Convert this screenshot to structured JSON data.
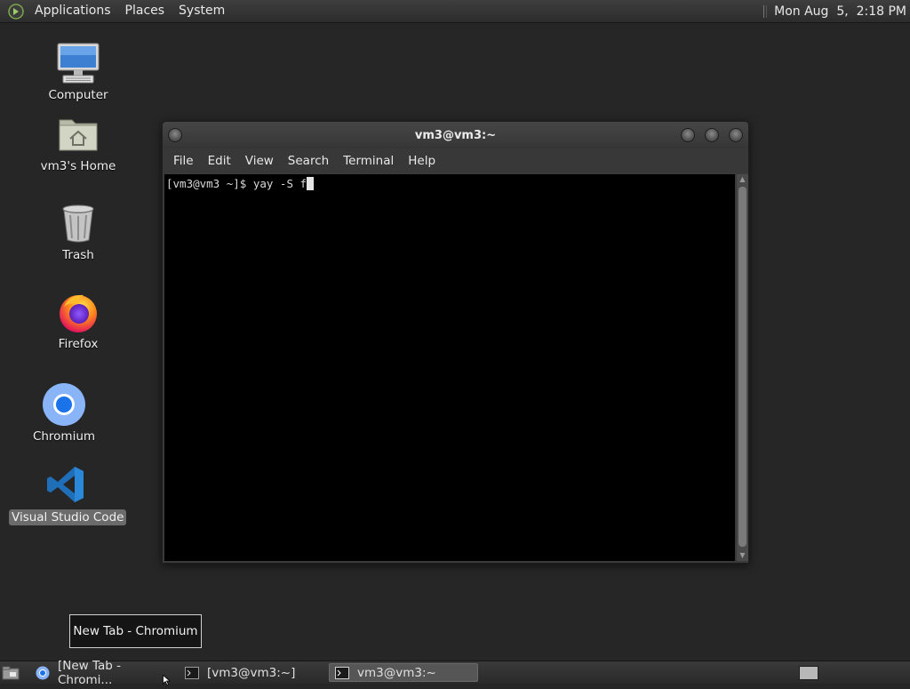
{
  "top_panel": {
    "menus": [
      "Applications",
      "Places",
      "System"
    ],
    "clock": "Mon Aug  5,  2:18 PM"
  },
  "desktop": {
    "icons": [
      {
        "label": "Computer",
        "icon": "computer-icon"
      },
      {
        "label": "vm3's Home",
        "icon": "home-folder-icon"
      },
      {
        "label": "Trash",
        "icon": "trash-icon"
      },
      {
        "label": "Firefox",
        "icon": "firefox-icon"
      },
      {
        "label": "Chromium",
        "icon": "chromium-icon"
      },
      {
        "label": "Visual Studio Code",
        "icon": "vscode-icon",
        "selected": true
      }
    ]
  },
  "terminal": {
    "title": "vm3@vm3:~",
    "menu": [
      "File",
      "Edit",
      "View",
      "Search",
      "Terminal",
      "Help"
    ],
    "prompt": "[vm3@vm3 ~]$ yay -S f"
  },
  "tooltip": "New Tab - Chromium",
  "taskbar": {
    "tasks": [
      {
        "label": "[New Tab - Chromi...",
        "icon": "chromium-icon"
      },
      {
        "label": "[vm3@vm3:~]",
        "icon": "terminal-icon"
      },
      {
        "label": "vm3@vm3:~",
        "icon": "terminal-icon",
        "active": true
      }
    ]
  },
  "colors": {
    "desktop_bg": "#262626",
    "panel_bg": "#333333",
    "terminal_bg": "#000000"
  }
}
